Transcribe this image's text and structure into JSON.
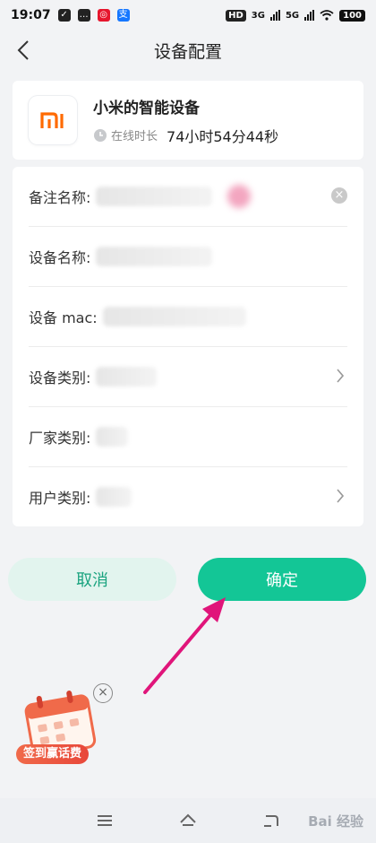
{
  "status_bar": {
    "time": "19:07",
    "hd": "HD",
    "net1": "3G",
    "net2": "5G",
    "battery": "100"
  },
  "header": {
    "title": "设备配置"
  },
  "device": {
    "name": "小米的智能设备",
    "online_label": "在线时长",
    "online_duration": "74小时54分44秒",
    "logo_text": "mi"
  },
  "form": {
    "rows": [
      {
        "label": "备注名称:"
      },
      {
        "label": "设备名称:"
      },
      {
        "label": "设备 mac:"
      },
      {
        "label": "设备类别:"
      },
      {
        "label": "厂家类别:"
      },
      {
        "label": "用户类别:"
      }
    ]
  },
  "buttons": {
    "cancel": "取消",
    "confirm": "确定"
  },
  "promo": {
    "label": "签到赢话费"
  },
  "watermark": "Bai 经验",
  "colors": {
    "accent": "#13c696",
    "cancel_bg": "#e2f4ee",
    "arrow": "#e0157a",
    "mi_orange": "#ff6a00"
  }
}
